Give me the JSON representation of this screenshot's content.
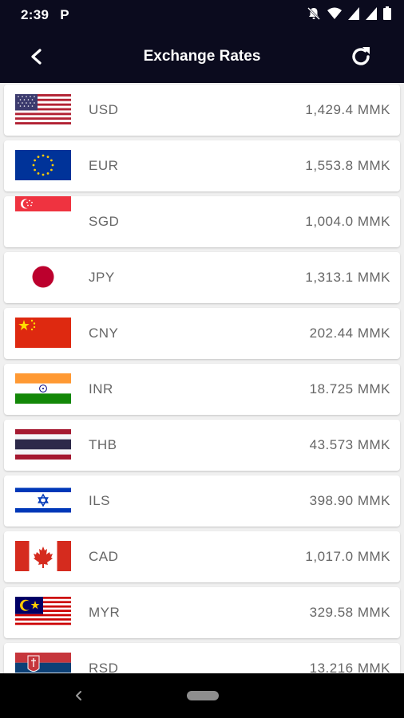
{
  "status_bar": {
    "time": "2:39",
    "notification": "P",
    "icons": [
      "notifications-off-icon",
      "wifi-icon",
      "signal-icon",
      "signal-icon",
      "battery-icon"
    ]
  },
  "app_bar": {
    "title": "Exchange Rates",
    "back_icon": "chevron-left-icon",
    "refresh_icon": "refresh-icon"
  },
  "rates": [
    {
      "code": "USD",
      "rate": "1,429.4 MMK",
      "flag": "us-flag-icon"
    },
    {
      "code": "EUR",
      "rate": "1,553.8 MMK",
      "flag": "eu-flag-icon"
    },
    {
      "code": "SGD",
      "rate": "1,004.0 MMK",
      "flag": "sg-flag-icon"
    },
    {
      "code": "JPY",
      "rate": "1,313.1 MMK",
      "flag": "jp-flag-icon"
    },
    {
      "code": "CNY",
      "rate": "202.44 MMK",
      "flag": "cn-flag-icon"
    },
    {
      "code": "INR",
      "rate": "18.725 MMK",
      "flag": "in-flag-icon"
    },
    {
      "code": "THB",
      "rate": "43.573 MMK",
      "flag": "th-flag-icon"
    },
    {
      "code": "ILS",
      "rate": "398.90 MMK",
      "flag": "il-flag-icon"
    },
    {
      "code": "CAD",
      "rate": "1,017.0 MMK",
      "flag": "ca-flag-icon"
    },
    {
      "code": "MYR",
      "rate": "329.58 MMK",
      "flag": "my-flag-icon"
    },
    {
      "code": "RSD",
      "rate": "13.216 MMK",
      "flag": "rs-flag-icon"
    }
  ],
  "nav_bar": {
    "back_icon": "nav-back-icon",
    "home_icon": "nav-home-pill-icon"
  },
  "colors": {
    "header_bg": "#0b0b1e",
    "row_bg": "#ffffff",
    "text": "#666666",
    "page_bg": "#f0f0f0"
  }
}
